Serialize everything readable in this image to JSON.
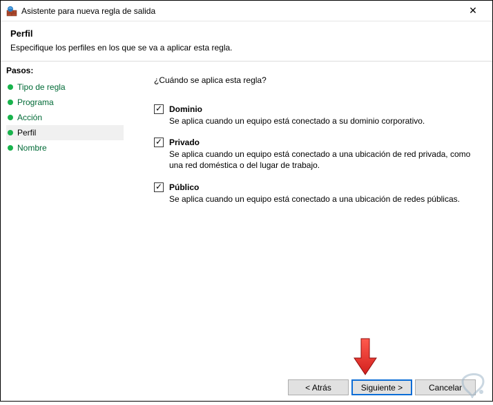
{
  "window": {
    "title": "Asistente para nueva regla de salida"
  },
  "header": {
    "title": "Perfil",
    "subtitle": "Especifique los perfiles en los que se va a aplicar esta regla."
  },
  "sidebar": {
    "steps_label": "Pasos:",
    "steps": [
      {
        "label": "Tipo de regla",
        "active": false
      },
      {
        "label": "Programa",
        "active": false
      },
      {
        "label": "Acción",
        "active": false
      },
      {
        "label": "Perfil",
        "active": true
      },
      {
        "label": "Nombre",
        "active": false
      }
    ]
  },
  "content": {
    "question": "¿Cuándo se aplica esta regla?",
    "options": [
      {
        "name": "Dominio",
        "checked": true,
        "description": "Se aplica cuando un equipo está conectado a su dominio corporativo."
      },
      {
        "name": "Privado",
        "checked": true,
        "description": "Se aplica cuando un equipo está conectado a una ubicación de red privada, como una red doméstica o del lugar de trabajo."
      },
      {
        "name": "Público",
        "checked": true,
        "description": "Se aplica cuando un equipo está conectado a una ubicación de redes públicas."
      }
    ]
  },
  "buttons": {
    "back": "< Atrás",
    "next": "Siguiente >",
    "cancel": "Cancelar"
  }
}
